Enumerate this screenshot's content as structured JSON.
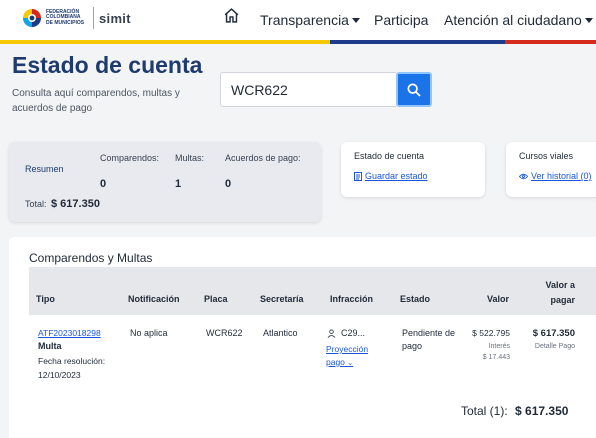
{
  "header": {
    "logo_text": "FEDERACIÓN COLOMBIANA DE MUNICIPIOS",
    "logo_brand": "simit",
    "nav": [
      {
        "label": "Transparencia",
        "dropdown": true
      },
      {
        "label": "Participa",
        "dropdown": false
      },
      {
        "label": "Atención al ciudadano",
        "dropdown": true
      }
    ],
    "home_icon": "home-icon"
  },
  "colors": {
    "title": "#1e3a6e",
    "accent": "#1a73e8",
    "stripe": [
      "#f6c800",
      "#1e3a8a",
      "#d52b1e"
    ]
  },
  "page": {
    "title": "Estado de cuenta",
    "subtitle": "Consulta aquí comparendos, multas y acuerdos de pago"
  },
  "search": {
    "value": "WCR622",
    "button_icon": "search-icon"
  },
  "summary": {
    "label": "Resumen",
    "total_label": "Total:",
    "total_value": "$ 617.350",
    "items": [
      {
        "label": "Comparendos:",
        "value": "0"
      },
      {
        "label": "Multas:",
        "value": "1"
      },
      {
        "label": "Acuerdos de pago:",
        "value": "0"
      }
    ]
  },
  "estado_card": {
    "title": "Estado de cuenta",
    "link": "Guardar estado"
  },
  "cursos_card": {
    "title": "Cursos viales",
    "link": "Ver historial (0)"
  },
  "table": {
    "title": "Comparendos y Multas",
    "columns": [
      "Tipo",
      "Notificación",
      "Placa",
      "Secretaría",
      "Infracción",
      "Estado",
      "Valor",
      "Valor a pagar"
    ],
    "rows": [
      {
        "id": "ATF2023018298",
        "tipo": "Multa",
        "fecha_label": "Fecha resolución:",
        "fecha": "12/10/2023",
        "notificacion": "No aplica",
        "placa": "WCR622",
        "secretaria": "Atlantico",
        "infraccion": "C29...",
        "proyeccion": "Proyección pago",
        "estado": "Pendiente de pago",
        "valor": "$ 522.795",
        "interes_label": "Interés",
        "interes": "$ 17.443",
        "valor_pagar": "$ 617.350",
        "detalle": "Detalle Pago"
      }
    ],
    "total_label": "Total (1):",
    "total_value": "$ 617.350"
  }
}
